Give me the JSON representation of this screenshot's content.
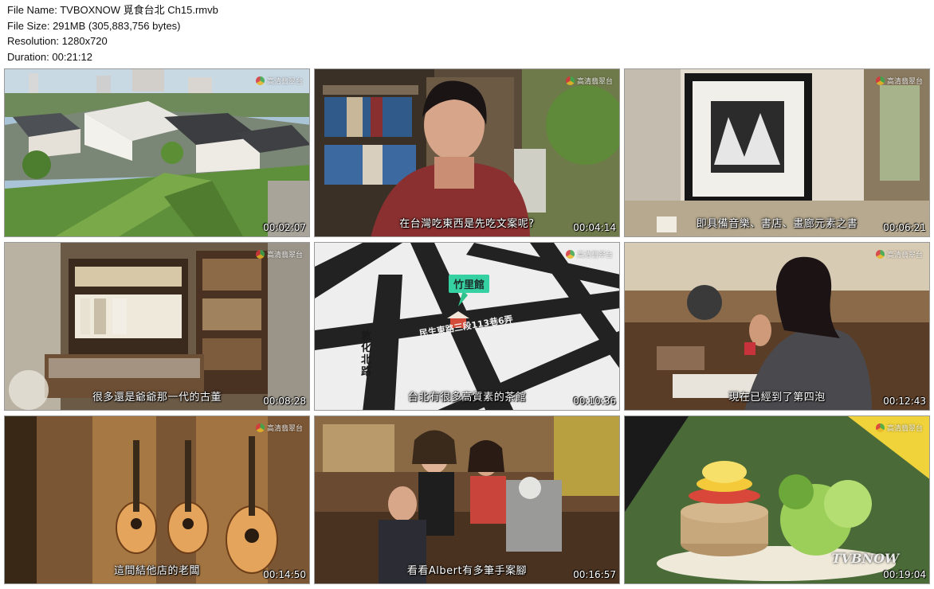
{
  "file_info": {
    "name_line": "File Name: TVBOXNOW 覓食台北 Ch15.rmvb",
    "size_line": "File Size: 291MB (305,883,756 bytes)",
    "resolution_line": "Resolution: 1280x720",
    "duration_line": "Duration: 00:21:12"
  },
  "channel_logo": "高清翡翠台",
  "thumbnails": [
    {
      "scene": "aerial-village",
      "subtitle": "",
      "timestamp": "00:02:07"
    },
    {
      "scene": "interview-bookshelf",
      "subtitle": "在台灣吃東西是先吃文案呢?",
      "timestamp": "00:04:14"
    },
    {
      "scene": "framed-print",
      "subtitle": "即具備音樂、書店、畫廊元素之書",
      "timestamp": "00:06:21"
    },
    {
      "scene": "antique-shop",
      "subtitle": "很多還是爺爺那一代的古董",
      "timestamp": "00:08:28"
    },
    {
      "scene": "map",
      "subtitle": "台北有很多高質素的茶館",
      "timestamp": "00:10:36",
      "map": {
        "place": "竹里館",
        "road_vertical": "敦化北路",
        "road_horizontal": "民生東路三段113巷6弄"
      }
    },
    {
      "scene": "interview-teahouse",
      "subtitle": "現在已經到了第四泡",
      "timestamp": "00:12:43"
    },
    {
      "scene": "guitar-shop",
      "subtitle": "這間結他店的老闆",
      "timestamp": "00:14:50"
    },
    {
      "scene": "workshop",
      "subtitle": "看看Albert有多筆手案腳",
      "timestamp": "00:16:57"
    },
    {
      "scene": "pancake",
      "subtitle": "",
      "timestamp": "00:19:04",
      "watermark": "TVBNOW"
    }
  ]
}
